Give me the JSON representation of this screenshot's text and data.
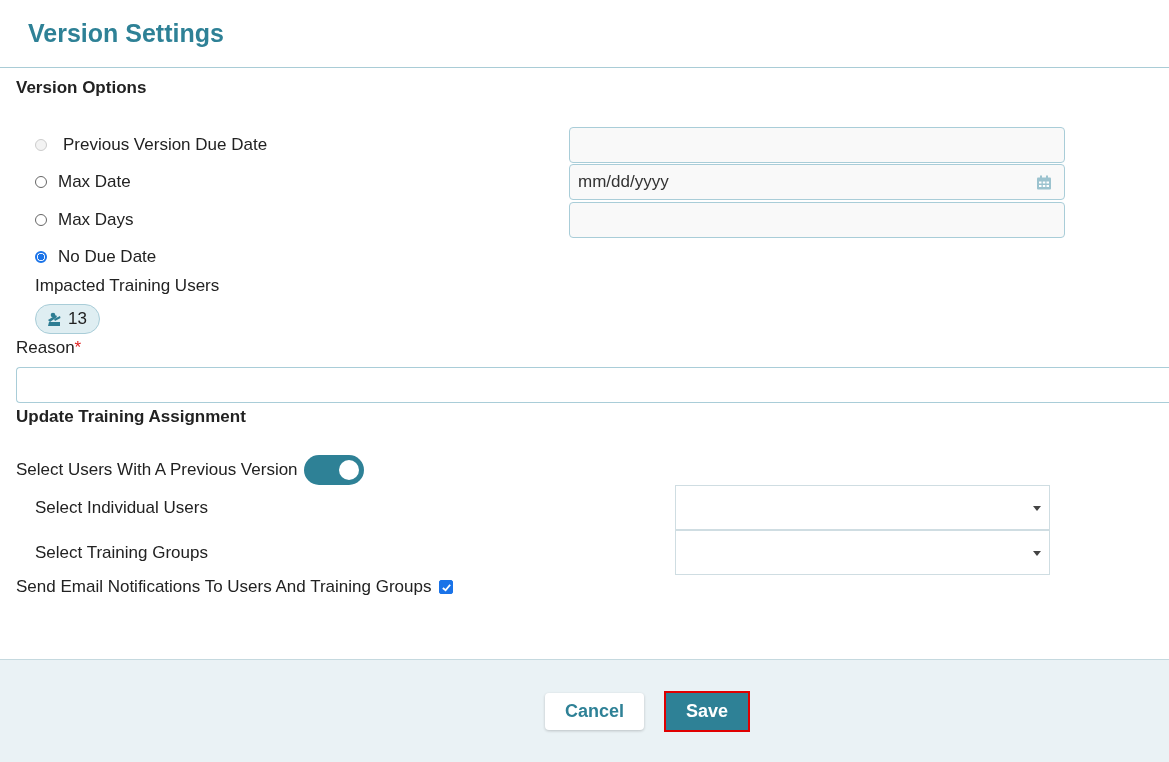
{
  "title": "Version Settings",
  "version_options": {
    "heading": "Version Options",
    "options": [
      {
        "label": "Previous Version Due Date",
        "selected": false,
        "disabled": true,
        "field": {
          "kind": "text"
        }
      },
      {
        "label": "Max Date",
        "selected": false,
        "disabled": false,
        "field": {
          "kind": "date",
          "placeholder": "mm/dd/yyyy"
        }
      },
      {
        "label": "Max Days",
        "selected": false,
        "disabled": false,
        "field": {
          "kind": "text"
        }
      },
      {
        "label": "No Due Date",
        "selected": true,
        "disabled": false
      }
    ],
    "impacted_label": "Impacted Training Users",
    "impacted_count": "13",
    "reason_label": "Reason",
    "reason_required": "*"
  },
  "update_training": {
    "heading": "Update Training Assignment",
    "previous_version_toggle": {
      "label": "Select Users With A Previous Version",
      "on": true
    },
    "selects": [
      {
        "label": "Select Individual Users"
      },
      {
        "label": "Select Training Groups"
      }
    ],
    "email": {
      "label": "Send Email Notifications To Users And Training Groups",
      "checked": true
    }
  },
  "buttons": [
    {
      "label": "Cancel",
      "kind": "secondary",
      "focused": false
    },
    {
      "label": "Save",
      "kind": "primary",
      "focused": true
    }
  ]
}
